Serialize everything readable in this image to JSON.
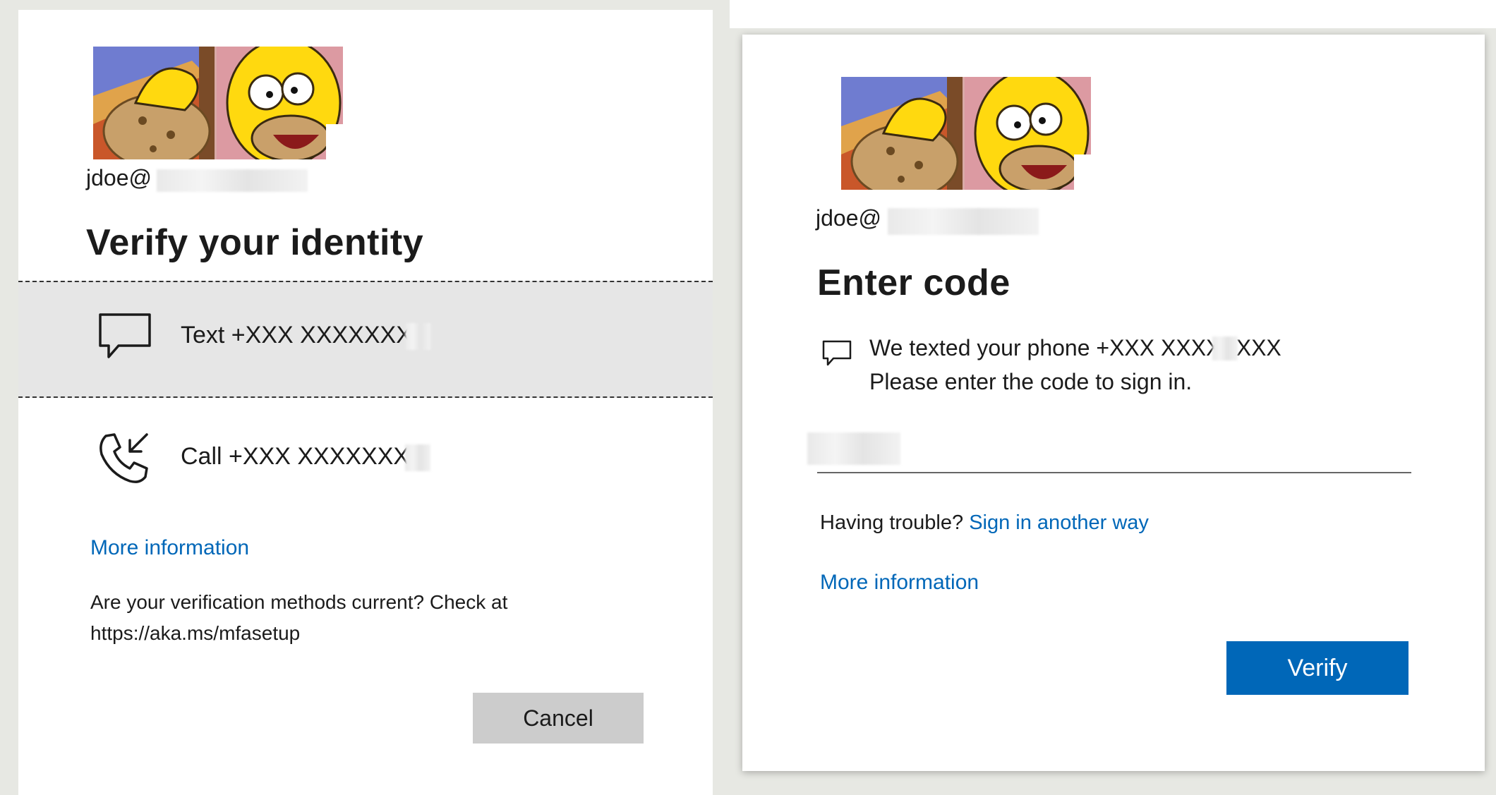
{
  "left": {
    "account_prefix": "jdoe@",
    "title": "Verify your identity",
    "options": [
      {
        "label": "Text +XXX XXXXXXXX",
        "icon": "chat-bubble-icon"
      },
      {
        "label": "Call +XXX XXXXXXXX",
        "icon": "phone-incoming-icon"
      }
    ],
    "more_info": "More information",
    "notice_line1": "Are your verification methods current? Check at",
    "notice_line2": "https://aka.ms/mfasetup",
    "cancel_label": "Cancel"
  },
  "right": {
    "account_prefix": "jdoe@",
    "title": "Enter code",
    "message_line1": "We texted your phone +XXX XXXXXXXX",
    "message_line2": "Please enter the code to sign in.",
    "code_value": "",
    "trouble_text": "Having trouble?",
    "trouble_link": "Sign in another way",
    "more_info": "More information",
    "verify_label": "Verify"
  },
  "colors": {
    "accent": "#0067b8",
    "selected_option_bg": "#e6e6e6",
    "cancel_bg": "#cccccc"
  }
}
